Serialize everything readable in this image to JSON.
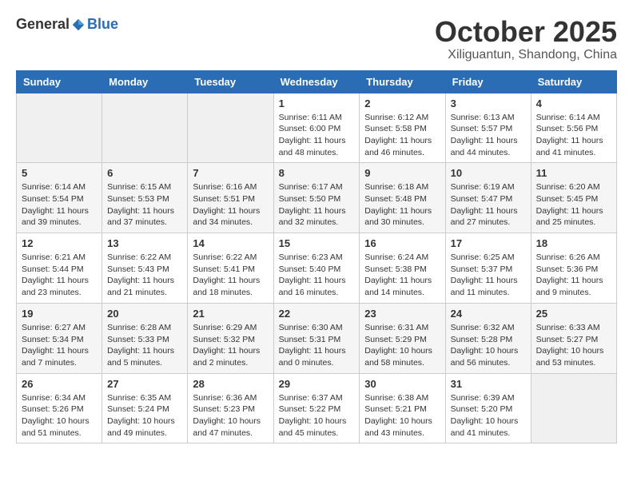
{
  "logo": {
    "general": "General",
    "blue": "Blue"
  },
  "title": "October 2025",
  "location": "Xiliguantun, Shandong, China",
  "days_of_week": [
    "Sunday",
    "Monday",
    "Tuesday",
    "Wednesday",
    "Thursday",
    "Friday",
    "Saturday"
  ],
  "weeks": [
    [
      {
        "day": "",
        "info": ""
      },
      {
        "day": "",
        "info": ""
      },
      {
        "day": "",
        "info": ""
      },
      {
        "day": "1",
        "info": "Sunrise: 6:11 AM\nSunset: 6:00 PM\nDaylight: 11 hours\nand 48 minutes."
      },
      {
        "day": "2",
        "info": "Sunrise: 6:12 AM\nSunset: 5:58 PM\nDaylight: 11 hours\nand 46 minutes."
      },
      {
        "day": "3",
        "info": "Sunrise: 6:13 AM\nSunset: 5:57 PM\nDaylight: 11 hours\nand 44 minutes."
      },
      {
        "day": "4",
        "info": "Sunrise: 6:14 AM\nSunset: 5:56 PM\nDaylight: 11 hours\nand 41 minutes."
      }
    ],
    [
      {
        "day": "5",
        "info": "Sunrise: 6:14 AM\nSunset: 5:54 PM\nDaylight: 11 hours\nand 39 minutes."
      },
      {
        "day": "6",
        "info": "Sunrise: 6:15 AM\nSunset: 5:53 PM\nDaylight: 11 hours\nand 37 minutes."
      },
      {
        "day": "7",
        "info": "Sunrise: 6:16 AM\nSunset: 5:51 PM\nDaylight: 11 hours\nand 34 minutes."
      },
      {
        "day": "8",
        "info": "Sunrise: 6:17 AM\nSunset: 5:50 PM\nDaylight: 11 hours\nand 32 minutes."
      },
      {
        "day": "9",
        "info": "Sunrise: 6:18 AM\nSunset: 5:48 PM\nDaylight: 11 hours\nand 30 minutes."
      },
      {
        "day": "10",
        "info": "Sunrise: 6:19 AM\nSunset: 5:47 PM\nDaylight: 11 hours\nand 27 minutes."
      },
      {
        "day": "11",
        "info": "Sunrise: 6:20 AM\nSunset: 5:45 PM\nDaylight: 11 hours\nand 25 minutes."
      }
    ],
    [
      {
        "day": "12",
        "info": "Sunrise: 6:21 AM\nSunset: 5:44 PM\nDaylight: 11 hours\nand 23 minutes."
      },
      {
        "day": "13",
        "info": "Sunrise: 6:22 AM\nSunset: 5:43 PM\nDaylight: 11 hours\nand 21 minutes."
      },
      {
        "day": "14",
        "info": "Sunrise: 6:22 AM\nSunset: 5:41 PM\nDaylight: 11 hours\nand 18 minutes."
      },
      {
        "day": "15",
        "info": "Sunrise: 6:23 AM\nSunset: 5:40 PM\nDaylight: 11 hours\nand 16 minutes."
      },
      {
        "day": "16",
        "info": "Sunrise: 6:24 AM\nSunset: 5:38 PM\nDaylight: 11 hours\nand 14 minutes."
      },
      {
        "day": "17",
        "info": "Sunrise: 6:25 AM\nSunset: 5:37 PM\nDaylight: 11 hours\nand 11 minutes."
      },
      {
        "day": "18",
        "info": "Sunrise: 6:26 AM\nSunset: 5:36 PM\nDaylight: 11 hours\nand 9 minutes."
      }
    ],
    [
      {
        "day": "19",
        "info": "Sunrise: 6:27 AM\nSunset: 5:34 PM\nDaylight: 11 hours\nand 7 minutes."
      },
      {
        "day": "20",
        "info": "Sunrise: 6:28 AM\nSunset: 5:33 PM\nDaylight: 11 hours\nand 5 minutes."
      },
      {
        "day": "21",
        "info": "Sunrise: 6:29 AM\nSunset: 5:32 PM\nDaylight: 11 hours\nand 2 minutes."
      },
      {
        "day": "22",
        "info": "Sunrise: 6:30 AM\nSunset: 5:31 PM\nDaylight: 11 hours\nand 0 minutes."
      },
      {
        "day": "23",
        "info": "Sunrise: 6:31 AM\nSunset: 5:29 PM\nDaylight: 10 hours\nand 58 minutes."
      },
      {
        "day": "24",
        "info": "Sunrise: 6:32 AM\nSunset: 5:28 PM\nDaylight: 10 hours\nand 56 minutes."
      },
      {
        "day": "25",
        "info": "Sunrise: 6:33 AM\nSunset: 5:27 PM\nDaylight: 10 hours\nand 53 minutes."
      }
    ],
    [
      {
        "day": "26",
        "info": "Sunrise: 6:34 AM\nSunset: 5:26 PM\nDaylight: 10 hours\nand 51 minutes."
      },
      {
        "day": "27",
        "info": "Sunrise: 6:35 AM\nSunset: 5:24 PM\nDaylight: 10 hours\nand 49 minutes."
      },
      {
        "day": "28",
        "info": "Sunrise: 6:36 AM\nSunset: 5:23 PM\nDaylight: 10 hours\nand 47 minutes."
      },
      {
        "day": "29",
        "info": "Sunrise: 6:37 AM\nSunset: 5:22 PM\nDaylight: 10 hours\nand 45 minutes."
      },
      {
        "day": "30",
        "info": "Sunrise: 6:38 AM\nSunset: 5:21 PM\nDaylight: 10 hours\nand 43 minutes."
      },
      {
        "day": "31",
        "info": "Sunrise: 6:39 AM\nSunset: 5:20 PM\nDaylight: 10 hours\nand 41 minutes."
      },
      {
        "day": "",
        "info": ""
      }
    ]
  ]
}
